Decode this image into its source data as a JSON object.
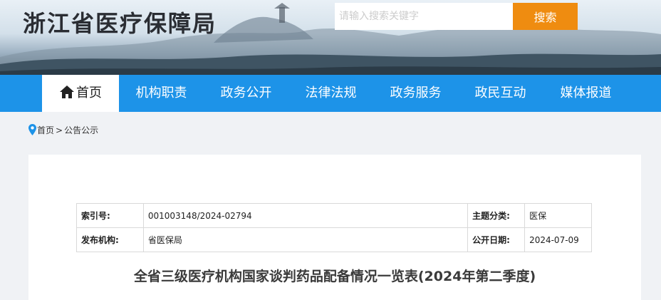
{
  "header": {
    "site_title": "浙江省医疗保障局",
    "search_placeholder": "请输入搜索关键字",
    "search_button_label": "搜索"
  },
  "nav": {
    "items": [
      {
        "label": "首页",
        "active": true,
        "icon": "home-icon"
      },
      {
        "label": "机构职责"
      },
      {
        "label": "政务公开"
      },
      {
        "label": "法律法规"
      },
      {
        "label": "政务服务"
      },
      {
        "label": "政民互动"
      },
      {
        "label": "媒体报道"
      }
    ]
  },
  "breadcrumb": {
    "icon": "location-pin-icon",
    "items": [
      "首页",
      "公告公示"
    ],
    "separator": ">"
  },
  "meta": {
    "index_label": "索引号:",
    "index_value": "001003148/2024-02794",
    "topic_label": "主题分类:",
    "topic_value": "医保",
    "publisher_label": "发布机构:",
    "publisher_value": "省医保局",
    "date_label": "公开日期:",
    "date_value": "2024-07-09"
  },
  "article": {
    "title": "全省三级医疗机构国家谈判药品配备情况一览表(2024年第二季度)"
  },
  "colors": {
    "nav_blue": "#1d93e8",
    "search_orange": "#ef8c10"
  }
}
